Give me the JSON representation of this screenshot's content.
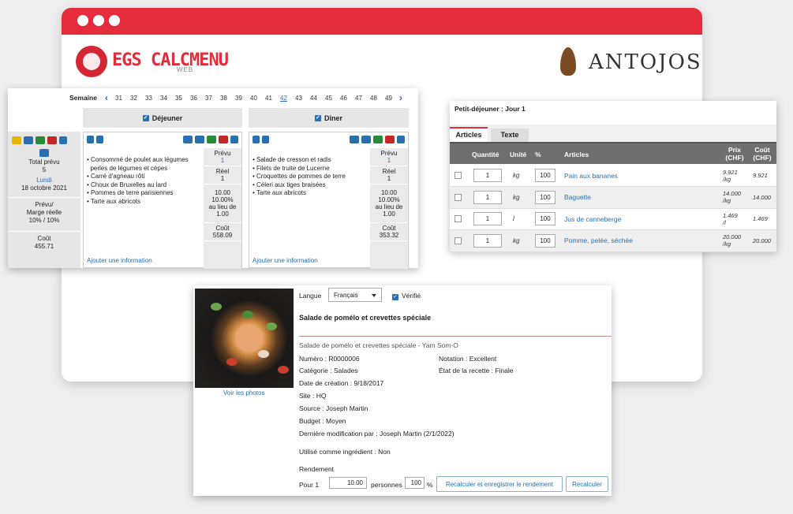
{
  "brand": {
    "name": "EGS CALCMENU",
    "sub": "WEB",
    "partner": "ANTOJOS"
  },
  "calendar": {
    "week_label": "Semaine",
    "weeks": [
      "31",
      "32",
      "33",
      "34",
      "35",
      "36",
      "37",
      "38",
      "39",
      "40",
      "41",
      "42",
      "43",
      "44",
      "45",
      "46",
      "47",
      "48",
      "49"
    ],
    "current_week": "42",
    "left": {
      "total_label": "Total prévu",
      "total_value": "5",
      "day": "Lundi",
      "date": "18 octobre 2021",
      "margin_label_1": "Prévu/",
      "margin_label_2": "Marge réelle",
      "margin_value": "10% / 10%",
      "cost_label": "Coût",
      "cost_value": "455.71"
    },
    "meals": [
      {
        "name": "Déjeuner",
        "items": [
          "• Consommé de poulet aux légumes",
          "  perles de légumes et cèpes",
          "• Carré d'agneau rôti",
          "• Choux de Bruxelles au lard",
          "• Pommes de terre parisiennes",
          "• Tarte aux abricots"
        ],
        "add_info": "Ajouter une information",
        "planned_label": "Prévu",
        "planned_value": "1",
        "real_label": "Réel",
        "real_value": "1",
        "price": "10.00",
        "pct": "10.00%",
        "instead": "au lieu de",
        "orig": "1.00",
        "cost_label": "Coût",
        "cost_value": "558.09"
      },
      {
        "name": "Dîner",
        "items": [
          "• Salade de cresson et radis",
          "• Filets de truite de Lucerne",
          "• Croquettes de pommes de terre",
          "• Céleri aux tiges braisées",
          "• Tarte aux abricots"
        ],
        "add_info": "Ajouter une information",
        "planned_label": "Prévu",
        "planned_value": "1",
        "real_label": "Réel",
        "real_value": "1",
        "price": "10.00",
        "pct": "10.00%",
        "instead": "au lieu de",
        "orig": "1.00",
        "cost_label": "Coût",
        "cost_value": "353.32"
      }
    ]
  },
  "articles": {
    "title": "Petit-déjeuner : Jour 1",
    "tabs": [
      "Articles",
      "Texte"
    ],
    "columns": [
      "Quantité",
      "Unité",
      "%",
      "Articles",
      "Prix (CHF)",
      "Coût (CHF)"
    ],
    "rows": [
      {
        "qty": "1",
        "unit": "kg",
        "pct": "100",
        "name": "Pain aux bananes",
        "price": "9.921",
        "price_unit": "/kg",
        "cost": "9.921"
      },
      {
        "qty": "1",
        "unit": "kg",
        "pct": "100",
        "name": "Baguette",
        "price": "14.000",
        "price_unit": "/kg",
        "cost": "14.000"
      },
      {
        "qty": "1",
        "unit": "l",
        "pct": "100",
        "name": "Jus de canneberge",
        "price": "1.469",
        "price_unit": "/l",
        "cost": "1.469"
      },
      {
        "qty": "1",
        "unit": "kg",
        "pct": "100",
        "name": "Pomme, pelée, séchée",
        "price": "20.000",
        "price_unit": "/kg",
        "cost": "20.000"
      }
    ]
  },
  "recipe": {
    "lang_label": "Langue",
    "lang_value": "Français",
    "verified_label": "Vérifié",
    "title": "Salade de pomélo et crevettes spéciale",
    "subtitle": "Salade de pomélo et crevettes spéciale - Yam Som-O",
    "number": "Numéro : R0000006",
    "rating": "Notation : Excellent",
    "category": "Catégorie : Salades",
    "state": "État de la recette : Finale",
    "created": "Date de création : 9/18/2017",
    "site": "Site : HQ",
    "source": "Source : Joseph Martin",
    "budget": "Budget : Moyen",
    "modified": "Dernière modification par : Joseph Martin (2/1/2022)",
    "used_as": "Utilisé comme ingrédient : Non",
    "yield_label": "Rendement",
    "for_label": "Pour 1",
    "yield_value": "10.00",
    "persons_label": "personnes",
    "pct_value": "100",
    "pct_label": "%",
    "btn_recalc_save": "Recalculer et enregistrer le rendement",
    "btn_recalc": "Recalculer",
    "photos_link": "Voir les photos"
  },
  "colors": {
    "accent": "#e42c3a",
    "link": "#2a6fb0"
  }
}
